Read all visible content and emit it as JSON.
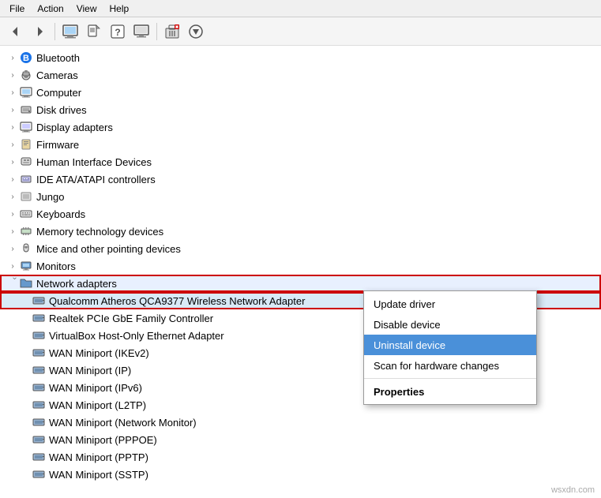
{
  "menubar": {
    "items": [
      "File",
      "Action",
      "View",
      "Help"
    ]
  },
  "toolbar": {
    "buttons": [
      {
        "name": "back",
        "icon": "◀",
        "disabled": false
      },
      {
        "name": "forward",
        "icon": "▶",
        "disabled": false
      },
      {
        "name": "properties",
        "icon": "🖥",
        "disabled": false
      },
      {
        "name": "update-driver",
        "icon": "📄",
        "disabled": false
      },
      {
        "name": "help",
        "icon": "❓",
        "disabled": false
      },
      {
        "name": "scan",
        "icon": "📺",
        "disabled": false
      },
      {
        "name": "uninstall",
        "icon": "❌",
        "disabled": false
      },
      {
        "name": "add",
        "icon": "⬇",
        "disabled": false
      }
    ]
  },
  "tree": {
    "items": [
      {
        "label": "Bluetooth",
        "level": 0,
        "expanded": false,
        "icon": "bluetooth"
      },
      {
        "label": "Cameras",
        "level": 0,
        "expanded": false,
        "icon": "camera"
      },
      {
        "label": "Computer",
        "level": 0,
        "expanded": false,
        "icon": "computer"
      },
      {
        "label": "Disk drives",
        "level": 0,
        "expanded": false,
        "icon": "disk"
      },
      {
        "label": "Display adapters",
        "level": 0,
        "expanded": false,
        "icon": "display"
      },
      {
        "label": "Firmware",
        "level": 0,
        "expanded": false,
        "icon": "firmware"
      },
      {
        "label": "Human Interface Devices",
        "level": 0,
        "expanded": false,
        "icon": "hid"
      },
      {
        "label": "IDE ATA/ATAPI controllers",
        "level": 0,
        "expanded": false,
        "icon": "ide"
      },
      {
        "label": "Jungo",
        "level": 0,
        "expanded": false,
        "icon": "jungo"
      },
      {
        "label": "Keyboards",
        "level": 0,
        "expanded": false,
        "icon": "keyboard"
      },
      {
        "label": "Memory technology devices",
        "level": 0,
        "expanded": false,
        "icon": "memory"
      },
      {
        "label": "Mice and other pointing devices",
        "level": 0,
        "expanded": false,
        "icon": "mouse"
      },
      {
        "label": "Monitors",
        "level": 0,
        "expanded": false,
        "icon": "monitor"
      },
      {
        "label": "Network adapters",
        "level": 0,
        "expanded": true,
        "icon": "network",
        "highlighted": true
      },
      {
        "label": "Qualcomm Atheros QCA9377 Wireless Network Adapter",
        "level": 1,
        "selected": true,
        "icon": "network-device"
      },
      {
        "label": "Realtek PCIe GbE Family Controller",
        "level": 1,
        "icon": "network-device"
      },
      {
        "label": "VirtualBox Host-Only Ethernet Adapter",
        "level": 1,
        "icon": "network-device"
      },
      {
        "label": "WAN Miniport (IKEv2)",
        "level": 1,
        "icon": "network-device"
      },
      {
        "label": "WAN Miniport (IP)",
        "level": 1,
        "icon": "network-device"
      },
      {
        "label": "WAN Miniport (IPv6)",
        "level": 1,
        "icon": "network-device"
      },
      {
        "label": "WAN Miniport (L2TP)",
        "level": 1,
        "icon": "network-device"
      },
      {
        "label": "WAN Miniport (Network Monitor)",
        "level": 1,
        "icon": "network-device"
      },
      {
        "label": "WAN Miniport (PPPOE)",
        "level": 1,
        "icon": "network-device"
      },
      {
        "label": "WAN Miniport (PPTP)",
        "level": 1,
        "icon": "network-device"
      },
      {
        "label": "WAN Miniport (SSTP)",
        "level": 1,
        "icon": "network-device"
      }
    ]
  },
  "context_menu": {
    "items": [
      {
        "label": "Update driver",
        "bold": false,
        "active": false
      },
      {
        "label": "Disable device",
        "bold": false,
        "active": false
      },
      {
        "label": "Uninstall device",
        "bold": false,
        "active": true
      },
      {
        "label": "Scan for hardware changes",
        "bold": false,
        "active": false
      },
      {
        "separator": true
      },
      {
        "label": "Properties",
        "bold": true,
        "active": false
      }
    ]
  },
  "watermark": "wsxdn.com"
}
